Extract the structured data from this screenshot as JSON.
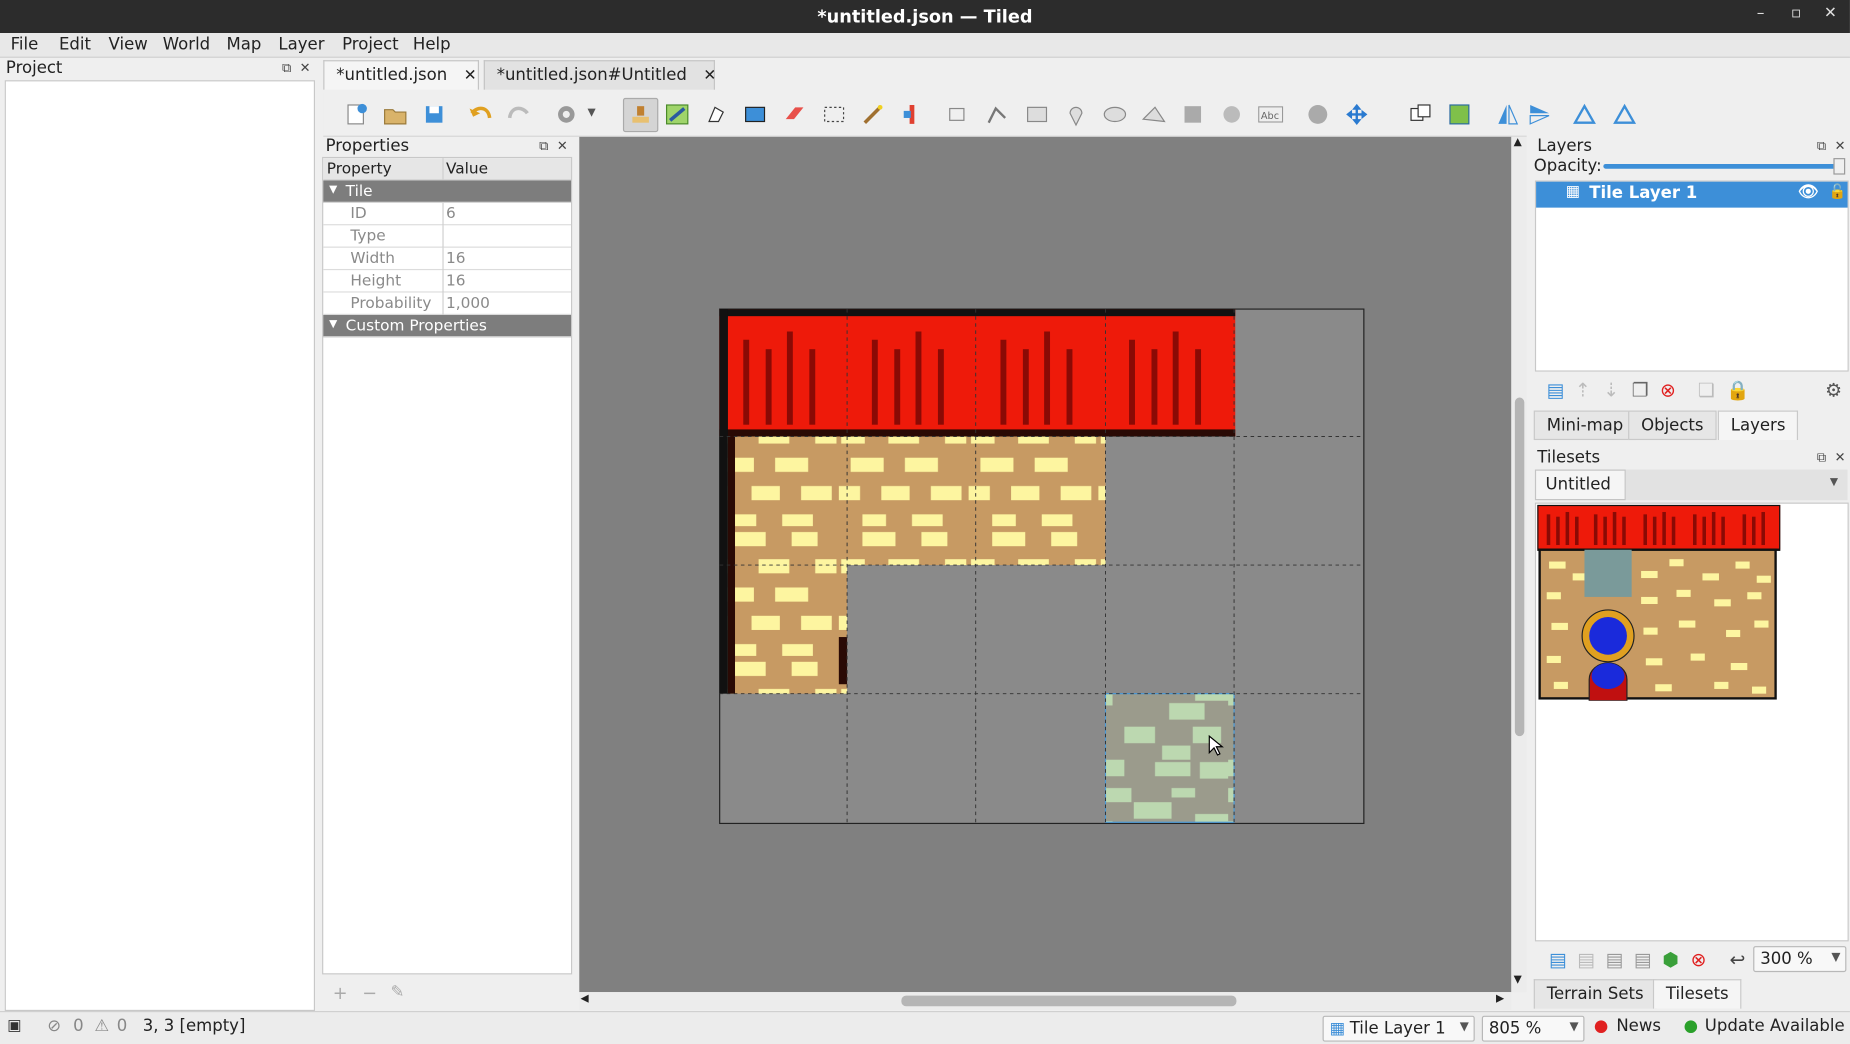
{
  "window": {
    "title": "*untitled.json — Tiled",
    "minimize": "–",
    "restore": "▫",
    "close": "✕"
  },
  "menu": [
    "File",
    "Edit",
    "View",
    "World",
    "Map",
    "Layer",
    "Project",
    "Help"
  ],
  "project_panel": {
    "title": "Project"
  },
  "tabs": [
    {
      "label": "*untitled.json",
      "close": "✕"
    },
    {
      "label": "*untitled.json#Untitled",
      "close": "✕"
    }
  ],
  "properties": {
    "title": "Properties",
    "col_property": "Property",
    "col_value": "Value",
    "group_tile": "Tile",
    "rows": [
      {
        "key": "ID",
        "value": "6"
      },
      {
        "key": "Type",
        "value": ""
      },
      {
        "key": "Width",
        "value": "16"
      },
      {
        "key": "Height",
        "value": "16"
      },
      {
        "key": "Probability",
        "value": "1,000"
      }
    ],
    "group_custom": "Custom Properties",
    "add": "+",
    "remove": "−",
    "edit": "✎"
  },
  "layers_panel": {
    "title": "Layers",
    "opacity_label": "Opacity:",
    "opacity": 1.0,
    "layer_name": "Tile Layer 1"
  },
  "mid_tabs": [
    "Mini-map",
    "Objects",
    "Layers"
  ],
  "tilesets_panel": {
    "title": "Tilesets",
    "tileset_tab": "Untitled",
    "zoom": "300 %"
  },
  "bottom_tabs": [
    "Terrain Sets",
    "Tilesets"
  ],
  "status": {
    "errors": "0",
    "warnings": "0",
    "position": "3, 3 [empty]",
    "layer": "Tile Layer 1",
    "zoom": "805 %",
    "news": "News",
    "update": "Update Available"
  },
  "colors": {
    "selection": "#3d8fd8",
    "roof": "#ee1a0a",
    "brick": "#c79a63",
    "brick_light": "#fdf5a0",
    "canvas_bg": "#808080",
    "map_bg": "#8a8a8a"
  }
}
